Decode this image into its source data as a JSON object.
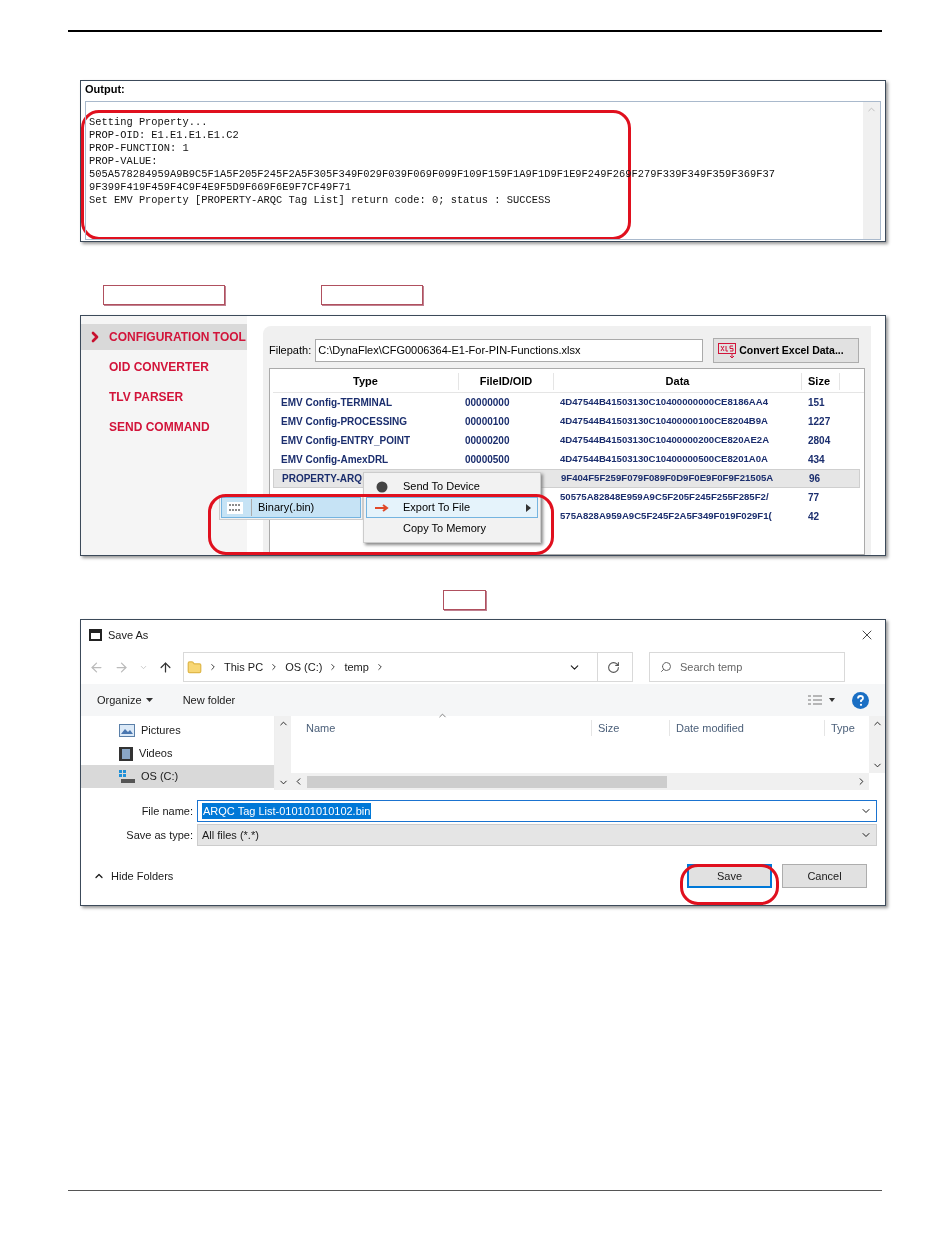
{
  "output_panel": {
    "label": "Output:",
    "lines": [
      "Setting Property...",
      "PROP-OID: E1.E1.E1.E1.C2",
      "PROP-FUNCTION: 1",
      "PROP-VALUE:",
      "505A578284959A9B9C5F1A5F205F245F2A5F305F349F029F039F069F099F109F159F1A9F1D9F1E9F249F269F279F339F349F359F369F37",
      "9F399F419F459F4C9F4E9F5D9F669F6E9F7CF49F71",
      "Set EMV Property [PROPERTY-ARQC Tag List] return code: 0; status : SUCCESS"
    ]
  },
  "config_tool": {
    "sidebar": [
      {
        "label": "CONFIGURATION TOOL",
        "selected": true
      },
      {
        "label": "OID CONVERTER",
        "selected": false
      },
      {
        "label": "TLV PARSER",
        "selected": false
      },
      {
        "label": "SEND COMMAND",
        "selected": false
      }
    ],
    "filepath": {
      "label": "Filepath:",
      "value": "C:\\DynaFlex\\CFG0006364-E1-For-PIN-Functions.xlsx"
    },
    "convert_button": {
      "label": "Convert Excel Data..."
    },
    "table": {
      "columns": [
        "Type",
        "FileID/OID",
        "Data",
        "Size"
      ],
      "rows": [
        {
          "type": "EMV Config-TERMINAL",
          "fileid": "00000000",
          "data": "4D47544B41503130C10400000000CE8186AA4",
          "size": "151",
          "selected": false
        },
        {
          "type": "EMV Config-PROCESSING",
          "fileid": "00000100",
          "data": "4D47544B41503130C10400000100CE8204B9A",
          "size": "1227",
          "selected": false
        },
        {
          "type": "EMV Config-ENTRY_POINT",
          "fileid": "00000200",
          "data": "4D47544B41503130C10400000200CE820AE2A",
          "size": "2804",
          "selected": false
        },
        {
          "type": "EMV Config-AmexDRL",
          "fileid": "00000500",
          "data": "4D47544B41503130C10400000500CE8201A0A",
          "size": "434",
          "selected": false
        },
        {
          "type": "PROPERTY-ARQ",
          "data": "9F404F5F259F079F089F0D9F0E9F0F9F21505A",
          "size": "96",
          "selected": true
        },
        {
          "data": "50575A82848E959A9C5F205F245F255F285F2/",
          "size": "77",
          "selected": false
        },
        {
          "data": "575A828A959A9C5F245F2A5F349F019F029F1(",
          "size": "42",
          "selected": false
        }
      ]
    },
    "context_menu": {
      "items": [
        {
          "label": "Send To Device",
          "kind": "device",
          "selected": false,
          "submenu": false
        },
        {
          "label": "Export To File",
          "kind": "export",
          "selected": true,
          "submenu": true
        },
        {
          "label": "Copy To Memory",
          "kind": "plain",
          "selected": false,
          "submenu": false
        }
      ]
    },
    "submenu": {
      "items": [
        {
          "label": "Binary(.bin)",
          "selected": true
        }
      ]
    }
  },
  "save_dialog": {
    "title": "Save As",
    "breadcrumbs": [
      "This PC",
      "OS (C:)",
      "temp"
    ],
    "search": {
      "placeholder": "Search temp"
    },
    "toolbar": [
      {
        "label": "Organize",
        "dropdown": true
      },
      {
        "label": "New folder",
        "dropdown": false
      }
    ],
    "nav_items": [
      {
        "label": "Pictures",
        "kind": "pictures",
        "selected": false
      },
      {
        "label": "Videos",
        "kind": "videos",
        "selected": false
      },
      {
        "label": "OS (C:)",
        "kind": "drive",
        "selected": true
      }
    ],
    "columns": [
      "Name",
      "Size",
      "Date modified",
      "Type"
    ],
    "file_name": {
      "label": "File name:",
      "value": "ARQC Tag List-010101010102.bin"
    },
    "save_as_type": {
      "label": "Save as type:",
      "value": "All files (*.*)"
    },
    "hide_folders": "Hide Folders",
    "buttons": [
      {
        "label": "Save",
        "default": true
      },
      {
        "label": "Cancel",
        "default": false
      }
    ]
  }
}
